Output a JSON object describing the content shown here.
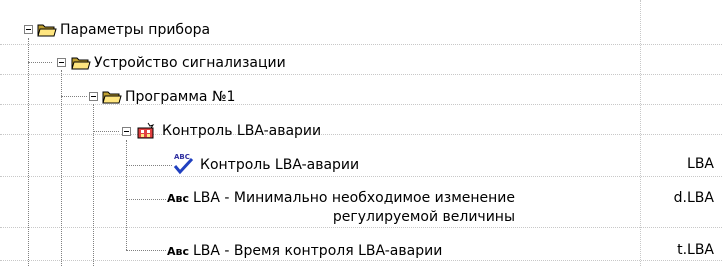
{
  "tree": {
    "root": {
      "label": "Параметры прибора"
    },
    "device": {
      "label": "Устройство сигнализации"
    },
    "program": {
      "label": "Программа №1"
    },
    "lba_group": {
      "label": "Контроль LBA-аварии"
    },
    "params": [
      {
        "icon_text": "",
        "label": "Контроль LBA-аварии",
        "value": "LBA"
      },
      {
        "icon_text": "Авс",
        "label_line1": "LBA - Минимально необходимое изменение",
        "label_line2": "регулируемой величины",
        "value": "d.LBA"
      },
      {
        "icon_text": "Авс",
        "label": "LBA - Время контроля LBA-аварии",
        "value": "t.LBA"
      }
    ]
  },
  "icons": {
    "folder": "open-folder-icon",
    "group": "alarm-group-icon",
    "check": "abc-check-icon",
    "text": "abc-text-icon"
  },
  "colors": {
    "folder_front": "#ffe680",
    "folder_back": "#c0a030",
    "grid": "#c8c8c8"
  }
}
